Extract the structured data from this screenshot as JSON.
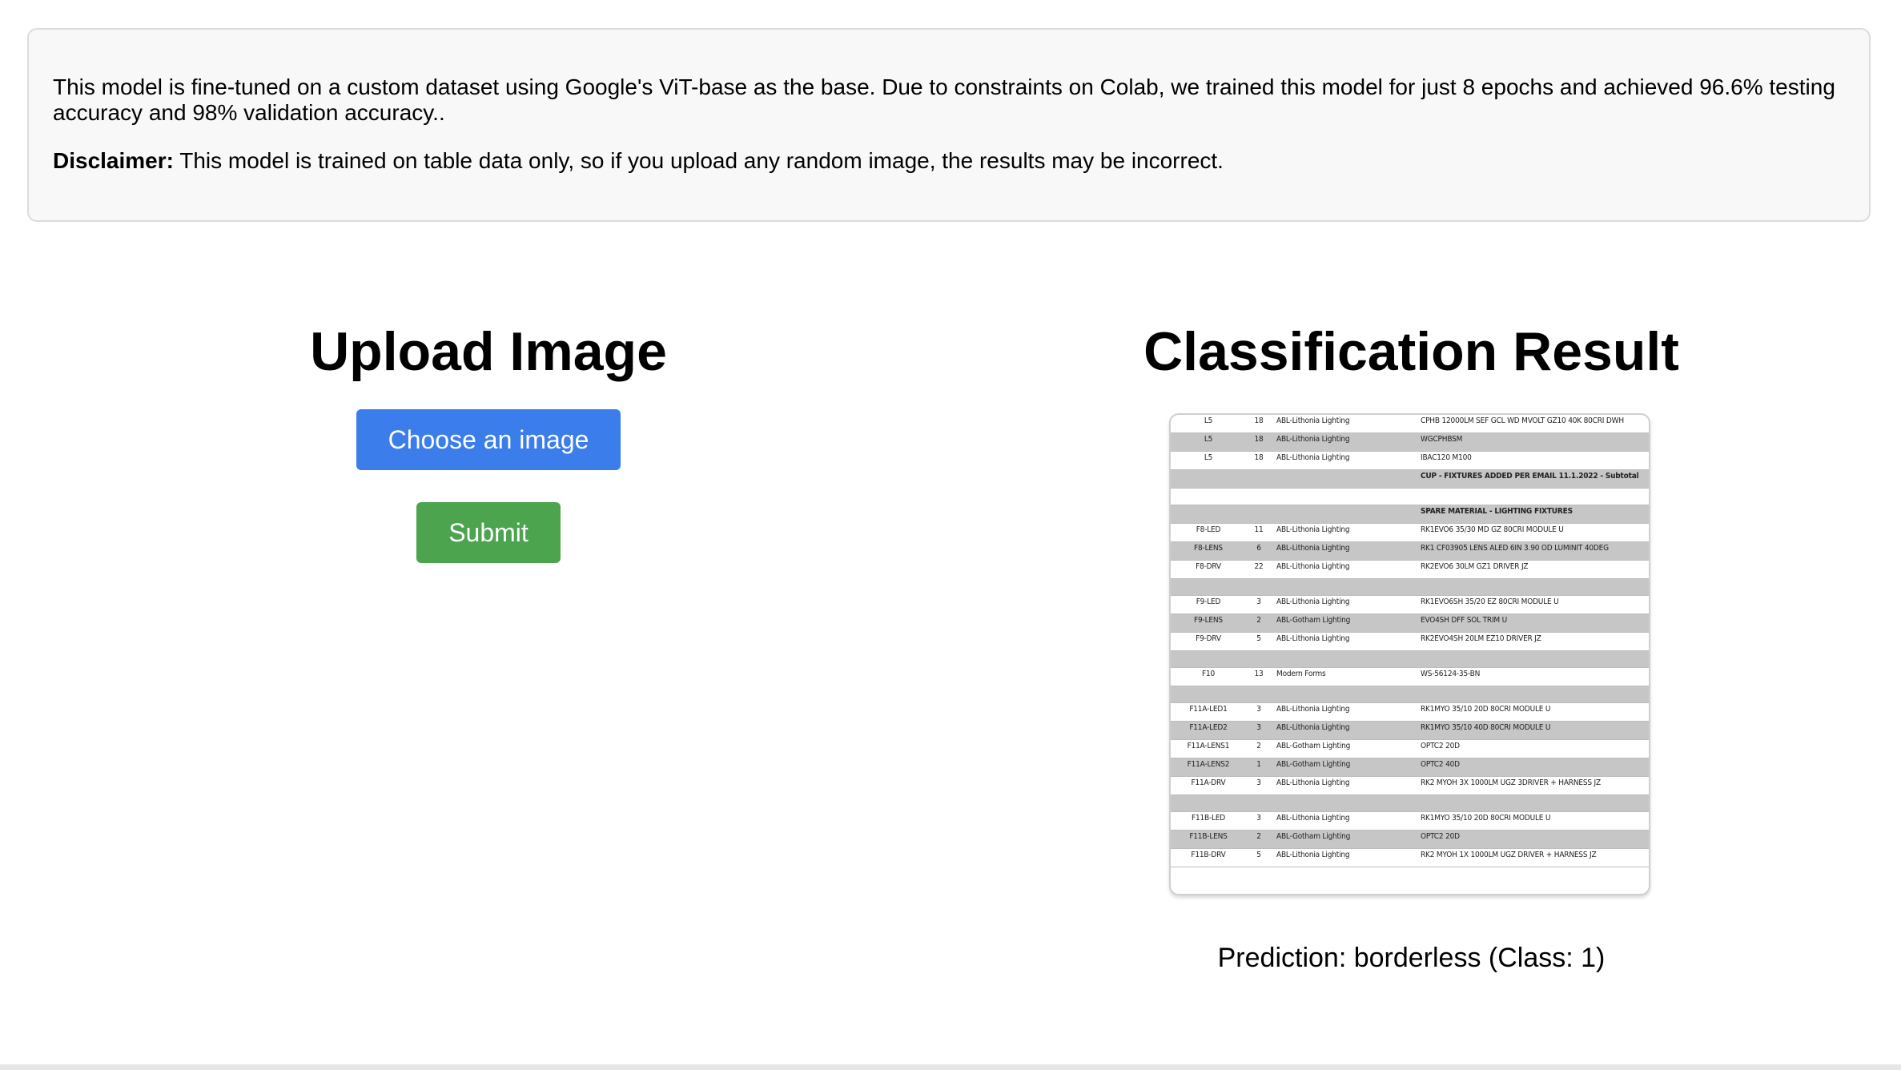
{
  "info": {
    "description": "This model is fine-tuned on a custom dataset using Google's ViT-base as the base. Due to constraints on Colab, we trained this model for just 8 epochs and achieved 96.6% testing accuracy and 98% validation accuracy..",
    "disclaimer_label": "Disclaimer:",
    "disclaimer_text": " This model is trained on table data only, so if you upload any random image, the results may be incorrect."
  },
  "upload": {
    "title": "Upload Image",
    "choose_label": "Choose an image",
    "submit_label": "Submit"
  },
  "result": {
    "title": "Classification Result",
    "prediction": "Prediction: borderless (Class: 1)",
    "table_rows": [
      {
        "kind": "data",
        "shade": false,
        "cells": [
          "L5",
          "18",
          "ABL-Lithonia Lighting",
          "CPHB 12000LM SEF GCL WD MVOLT GZ10 40K 80CRI DWH"
        ]
      },
      {
        "kind": "data",
        "shade": true,
        "cells": [
          "L5",
          "18",
          "ABL-Lithonia Lighting",
          "WGCPHBSM"
        ]
      },
      {
        "kind": "data",
        "shade": false,
        "cells": [
          "L5",
          "18",
          "ABL-Lithonia Lighting",
          "IBAC120 M100"
        ]
      },
      {
        "kind": "sec",
        "shade": true,
        "cells": [
          "",
          "",
          "",
          "CUP - FIXTURES ADDED PER EMAIL 11.1.2022 - Subtotal"
        ]
      },
      {
        "kind": "blank",
        "shade": false,
        "cells": [
          "",
          "",
          "",
          ""
        ]
      },
      {
        "kind": "sec",
        "shade": true,
        "cells": [
          "",
          "",
          "",
          "SPARE MATERIAL - LIGHTING FIXTURES"
        ]
      },
      {
        "kind": "data",
        "shade": false,
        "cells": [
          "F8-LED",
          "11",
          "ABL-Lithonia Lighting",
          "RK1EVO6 35/30 MD GZ 80CRI MODULE U"
        ]
      },
      {
        "kind": "data",
        "shade": true,
        "cells": [
          "F8-LENS",
          "6",
          "ABL-Lithonia Lighting",
          "RK1 CF03905 LENS ALED 6IN 3.90 OD LUMINIT 40DEG"
        ]
      },
      {
        "kind": "data",
        "shade": false,
        "cells": [
          "F8-DRV",
          "22",
          "ABL-Lithonia Lighting",
          "RK2EVO6 30LM GZ1 DRIVER JZ"
        ]
      },
      {
        "kind": "blank",
        "shade": true,
        "cells": [
          "",
          "",
          "",
          ""
        ]
      },
      {
        "kind": "data",
        "shade": false,
        "cells": [
          "F9-LED",
          "3",
          "ABL-Lithonia Lighting",
          "RK1EVO6SH 35/20 EZ 80CRI MODULE U"
        ]
      },
      {
        "kind": "data",
        "shade": true,
        "cells": [
          "F9-LENS",
          "2",
          "ABL-Gotham Lighting",
          "EVO4SH DFF SOL TRIM U"
        ]
      },
      {
        "kind": "data",
        "shade": false,
        "cells": [
          "F9-DRV",
          "5",
          "ABL-Lithonia Lighting",
          "RK2EVO4SH 20LM EZ10 DRIVER JZ"
        ]
      },
      {
        "kind": "blank",
        "shade": true,
        "cells": [
          "",
          "",
          "",
          ""
        ]
      },
      {
        "kind": "data",
        "shade": false,
        "cells": [
          "F10",
          "13",
          "Modern Forms",
          "WS-56124-35-BN"
        ]
      },
      {
        "kind": "blank",
        "shade": true,
        "cells": [
          "",
          "",
          "",
          ""
        ]
      },
      {
        "kind": "data",
        "shade": false,
        "cells": [
          "F11A-LED1",
          "3",
          "ABL-Lithonia Lighting",
          "RK1MYO 35/10 20D 80CRI MODULE U"
        ]
      },
      {
        "kind": "data",
        "shade": true,
        "cells": [
          "F11A-LED2",
          "3",
          "ABL-Lithonia Lighting",
          "RK1MYO 35/10 40D 80CRI MODULE U"
        ]
      },
      {
        "kind": "data",
        "shade": false,
        "cells": [
          "F11A-LENS1",
          "2",
          "ABL-Gotham Lighting",
          "OPTC2 20D"
        ]
      },
      {
        "kind": "data",
        "shade": true,
        "cells": [
          "F11A-LENS2",
          "1",
          "ABL-Gotham Lighting",
          "OPTC2 40D"
        ]
      },
      {
        "kind": "data",
        "shade": false,
        "cells": [
          "F11A-DRV",
          "3",
          "ABL-Lithonia Lighting",
          "RK2 MYOH 3X 1000LM UGZ 3DRIVER + HARNESS JZ"
        ]
      },
      {
        "kind": "blank",
        "shade": true,
        "cells": [
          "",
          "",
          "",
          ""
        ]
      },
      {
        "kind": "data",
        "shade": false,
        "cells": [
          "F11B-LED",
          "3",
          "ABL-Lithonia Lighting",
          "RK1MYO 35/10 20D 80CRI MODULE U"
        ]
      },
      {
        "kind": "data",
        "shade": true,
        "cells": [
          "F11B-LENS",
          "2",
          "ABL-Gotham Lighting",
          "OPTC2 20D"
        ]
      },
      {
        "kind": "data",
        "shade": false,
        "cells": [
          "F11B-DRV",
          "5",
          "ABL-Lithonia Lighting",
          "RK2 MYOH 1X 1000LM UGZ DRIVER + HARNESS JZ"
        ]
      }
    ]
  }
}
